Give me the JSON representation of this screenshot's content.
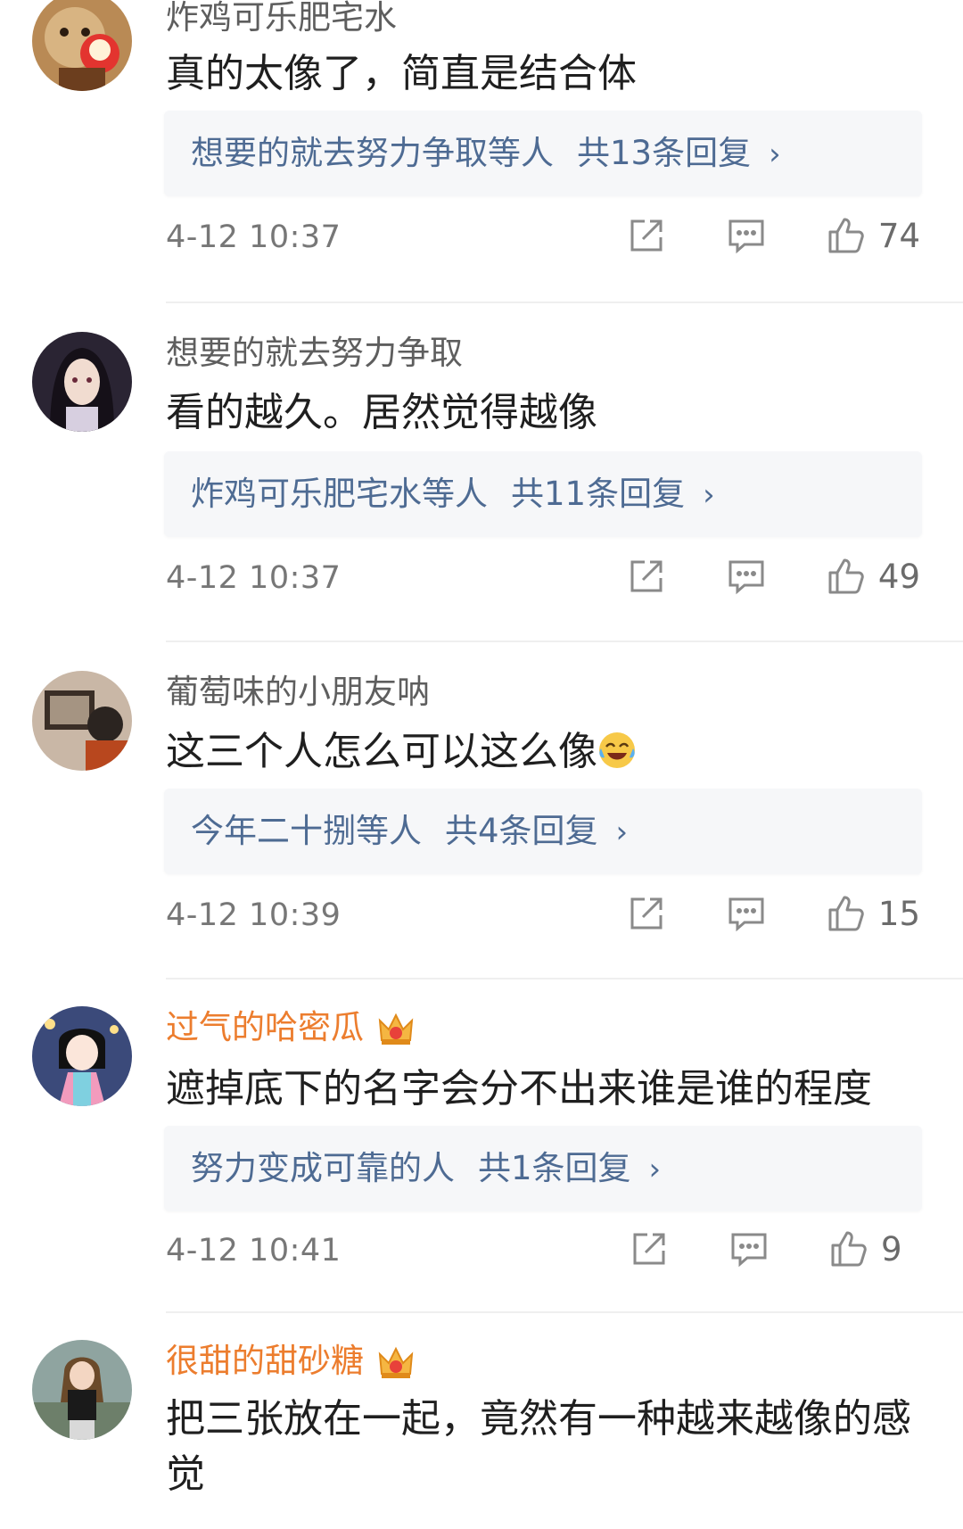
{
  "comments": [
    {
      "username": "炸鸡可乐肥宅水",
      "vip": false,
      "text": "真的太像了，简直是结合体",
      "reply_users": "想要的就去努力争取等人",
      "reply_count": "共13条回复",
      "time": "4-12 10:37",
      "likes": "74"
    },
    {
      "username": "想要的就去努力争取",
      "vip": false,
      "text": "看的越久。居然觉得越像",
      "reply_users": "炸鸡可乐肥宅水等人",
      "reply_count": "共11条回复",
      "time": "4-12 10:37",
      "likes": "49"
    },
    {
      "username": "葡萄味的小朋友呐",
      "vip": false,
      "text": "这三个人怎么可以这么像",
      "reply_users": "今年二十捌等人",
      "reply_count": "共4条回复",
      "time": "4-12 10:39",
      "likes": "15"
    },
    {
      "username": "过气的哈密瓜",
      "vip": true,
      "text": "遮掉底下的名字会分不出来谁是谁的程度",
      "reply_users": "努力变成可靠的人",
      "reply_count": "共1条回复",
      "time": "4-12 10:41",
      "likes": "9"
    },
    {
      "username": "很甜的甜砂糖",
      "vip": true,
      "text": "把三张放在一起，竟然有一种越来越像的感觉"
    }
  ],
  "icons": {
    "share": "share-icon",
    "comment": "comment-icon",
    "like": "thumbs-up-icon",
    "chevron": "›",
    "vip_badge": "crown-icon"
  },
  "colors": {
    "link": "#4e6b93",
    "vip_name": "#ec7d2e",
    "username": "#5e5e5e",
    "reply_bg": "#f6f7f9"
  }
}
